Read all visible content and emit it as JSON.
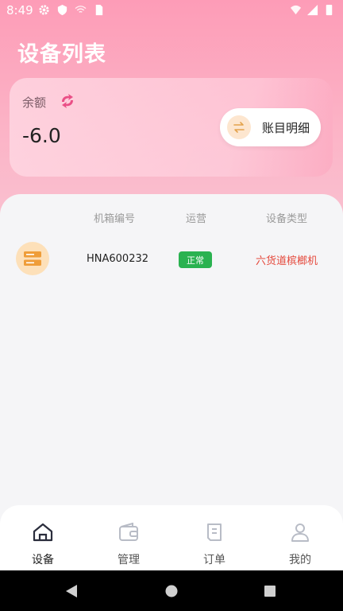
{
  "status_bar": {
    "time": "8:49"
  },
  "header": {
    "title": "设备列表"
  },
  "balance_card": {
    "label": "余额",
    "value": "-6.0",
    "detail_button_label": "账目明细"
  },
  "table": {
    "headers": [
      "机箱编号",
      "运营",
      "设备类型"
    ],
    "rows": [
      {
        "id": "HNA600232",
        "status": "正常",
        "type": "六货道槟榔机"
      }
    ]
  },
  "tabs": [
    {
      "label": "设备",
      "icon": "home-icon",
      "active": true
    },
    {
      "label": "管理",
      "icon": "wallet-icon",
      "active": false
    },
    {
      "label": "订单",
      "icon": "document-icon",
      "active": false
    },
    {
      "label": "我的",
      "icon": "person-icon",
      "active": false
    }
  ],
  "colors": {
    "header_gradient_top": "#fd9cb7",
    "status_ok": "#2ab250",
    "device_type_text": "#e5493c",
    "device_icon_bg": "#fde0b9"
  }
}
